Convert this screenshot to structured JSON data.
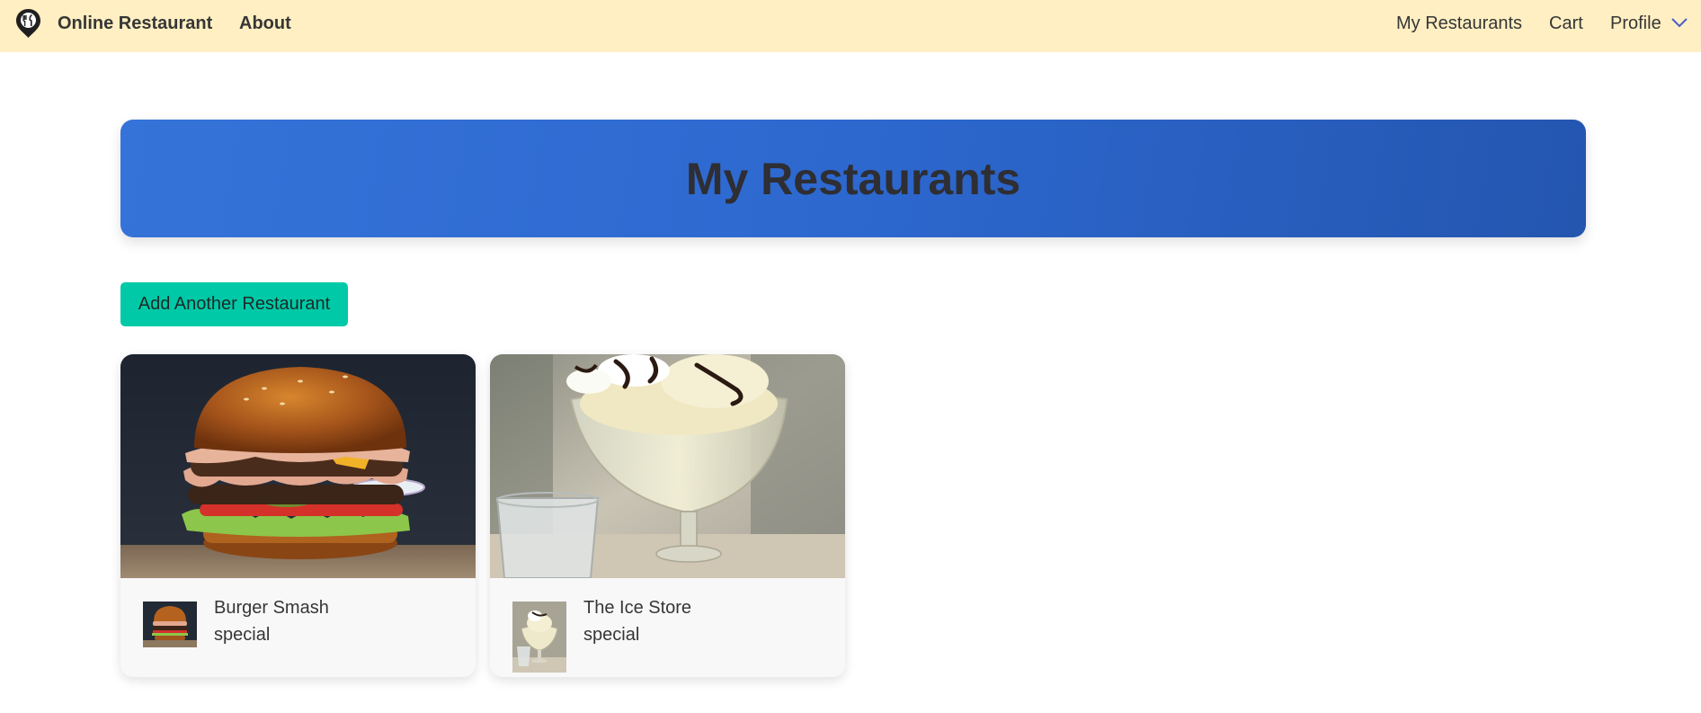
{
  "navbar": {
    "brand": "Online Restaurant",
    "about": "About",
    "my_restaurants": "My Restaurants",
    "cart": "Cart",
    "profile": "Profile",
    "logo_icon": "map-pin-cutlery-icon",
    "profile_icon": "chevron-down-icon",
    "background_color": "#ffefc2"
  },
  "hero": {
    "title": "My Restaurants",
    "gradient_colors": [
      "#3573d9",
      "#2456b0"
    ]
  },
  "actions": {
    "add_restaurant_label": "Add Another Restaurant",
    "accent_color": "#00c9a7"
  },
  "restaurants": [
    {
      "name": "Burger Smash",
      "tag": "special",
      "image": "burger-photo"
    },
    {
      "name": "The Ice Store",
      "tag": "special",
      "image": "ice-cream-sundae-photo"
    }
  ]
}
